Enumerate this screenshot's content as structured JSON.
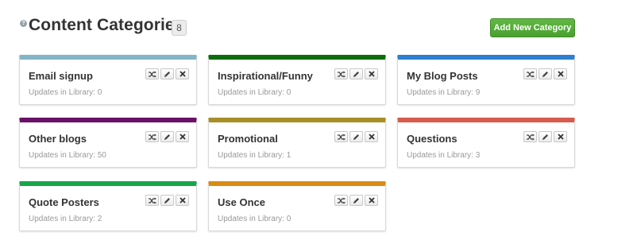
{
  "header": {
    "help_icon": "question-icon",
    "title": "Content Categories",
    "count": "8",
    "add_button_label": "Add New Category"
  },
  "colors": {
    "add_button": "#4aa02f"
  },
  "categories": [
    {
      "name": "Email signup",
      "updates": "Updates in Library: 0",
      "color": "#84b4c8"
    },
    {
      "name": "Inspirational/Funny",
      "updates": "Updates in Library: 0",
      "color": "#0d6d0d"
    },
    {
      "name": "My Blog Posts",
      "updates": "Updates in Library: 9",
      "color": "#2d7fcf"
    },
    {
      "name": "Other blogs",
      "updates": "Updates in Library: 50",
      "color": "#6a1268"
    },
    {
      "name": "Promotional",
      "updates": "Updates in Library: 1",
      "color": "#a88f28"
    },
    {
      "name": "Questions",
      "updates": "Updates in Library: 3",
      "color": "#d65c50"
    },
    {
      "name": "Quote Posters",
      "updates": "Updates in Library: 2",
      "color": "#17a64a"
    },
    {
      "name": "Use Once",
      "updates": "Updates in Library: 0",
      "color": "#d98c14"
    }
  ],
  "card_actions": {
    "shuffle_icon": "shuffle-icon",
    "edit_icon": "pencil-icon",
    "delete_icon": "close-icon"
  }
}
